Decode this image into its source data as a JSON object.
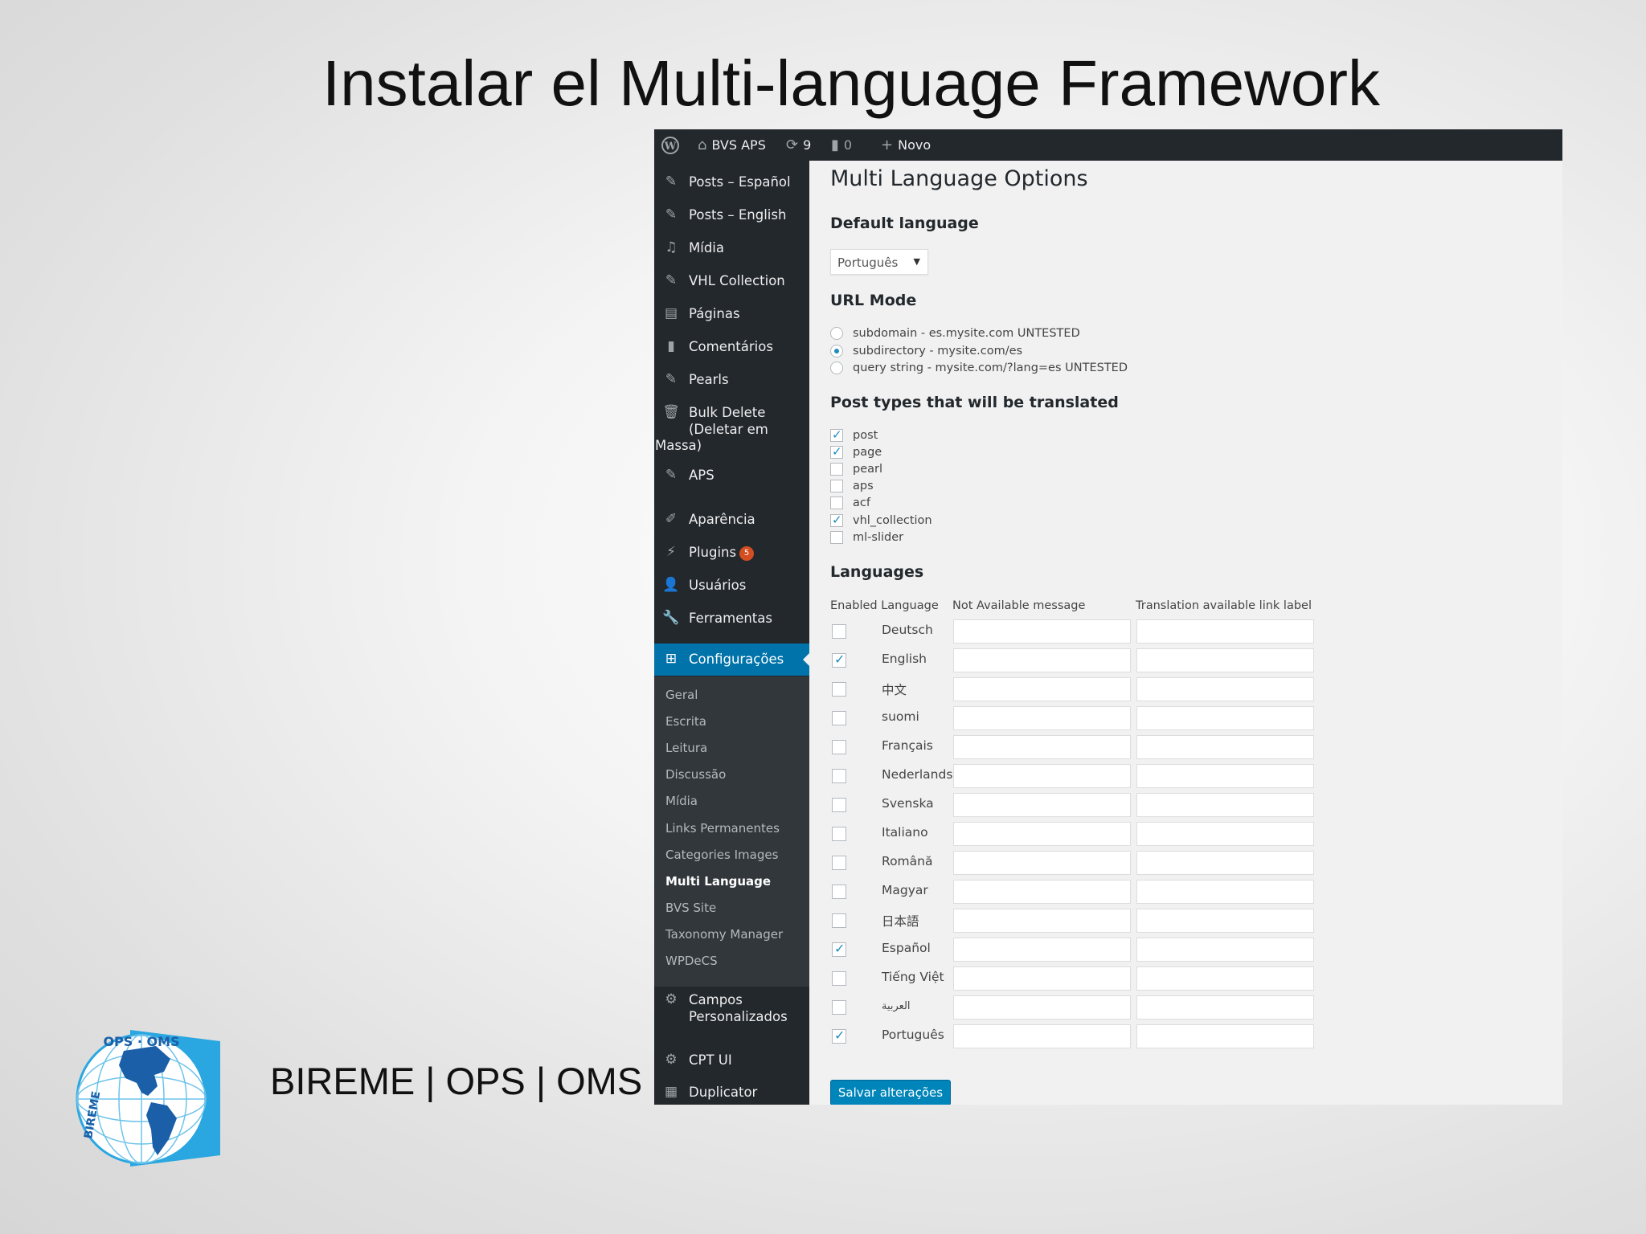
{
  "slide": {
    "title": "Instalar el Multi-language Framework",
    "footer": "BIREME | OPS | OMS",
    "logo_text_top": "OPS · OMS",
    "logo_text_side": "BIREME"
  },
  "topbar": {
    "site_name": "BVS APS",
    "updates_count": "9",
    "comments_count": "0",
    "new_label": "Novo"
  },
  "sidebar": {
    "items": [
      {
        "label": "Posts – Español",
        "icon": "pin-icon"
      },
      {
        "label": "Posts – English",
        "icon": "pin-icon"
      },
      {
        "label": "Mídia",
        "icon": "media-icon"
      },
      {
        "label": "VHL Collection",
        "icon": "pin-icon"
      },
      {
        "label": "Páginas",
        "icon": "pages-icon"
      },
      {
        "label": "Comentários",
        "icon": "comment-icon"
      },
      {
        "label": "Pearls",
        "icon": "pin-icon"
      },
      {
        "label": "Bulk Delete (Deletar em",
        "label2": "Massa)",
        "icon": "trash-icon"
      },
      {
        "label": "APS",
        "icon": "pin-icon"
      },
      {
        "label": "Aparência",
        "icon": "brush-icon"
      },
      {
        "label": "Plugins",
        "badge": "5",
        "icon": "plugin-icon"
      },
      {
        "label": "Usuários",
        "icon": "user-icon"
      },
      {
        "label": "Ferramentas",
        "icon": "wrench-icon"
      },
      {
        "label": "Configurações",
        "icon": "settings-icon"
      },
      {
        "label": "Campos Personalizados",
        "icon": "gear-icon"
      },
      {
        "label": "CPT UI",
        "icon": "gear-icon"
      },
      {
        "label": "Duplicator",
        "icon": "database-icon"
      }
    ],
    "submenu": [
      "Geral",
      "Escrita",
      "Leitura",
      "Discussão",
      "Mídia",
      "Links Permanentes",
      "Categories Images",
      "Multi Language",
      "BVS Site",
      "Taxonomy Manager",
      "WPDeCS"
    ]
  },
  "content": {
    "page_title": "Multi Language Options",
    "default_language_heading": "Default language",
    "default_language_value": "Português",
    "url_mode_heading": "URL Mode",
    "url_modes": [
      {
        "label": "subdomain - es.mysite.com UNTESTED",
        "selected": false
      },
      {
        "label": "subdirectory - mysite.com/es",
        "selected": true
      },
      {
        "label": "query string - mysite.com/?lang=es UNTESTED",
        "selected": false
      }
    ],
    "post_types_heading": "Post types that will be translated",
    "post_types": [
      {
        "label": "post",
        "checked": true
      },
      {
        "label": "page",
        "checked": true
      },
      {
        "label": "pearl",
        "checked": false
      },
      {
        "label": "aps",
        "checked": false
      },
      {
        "label": "acf",
        "checked": false
      },
      {
        "label": "vhl_collection",
        "checked": true
      },
      {
        "label": "ml-slider",
        "checked": false
      }
    ],
    "languages_heading": "Languages",
    "col_enabled": "Enabled Language",
    "col_not_available": "Not Available message",
    "col_translation": "Translation available link label",
    "languages": [
      {
        "name": "Deutsch",
        "enabled": false
      },
      {
        "name": "English",
        "enabled": true
      },
      {
        "name": "中文",
        "enabled": false
      },
      {
        "name": "suomi",
        "enabled": false
      },
      {
        "name": "Français",
        "enabled": false
      },
      {
        "name": "Nederlands",
        "enabled": false
      },
      {
        "name": "Svenska",
        "enabled": false
      },
      {
        "name": "Italiano",
        "enabled": false
      },
      {
        "name": "Română",
        "enabled": false
      },
      {
        "name": "Magyar",
        "enabled": false
      },
      {
        "name": "日本語",
        "enabled": false
      },
      {
        "name": "Español",
        "enabled": true
      },
      {
        "name": "Tiếng Việt",
        "enabled": false
      },
      {
        "name": "العربية",
        "enabled": false
      },
      {
        "name": "Português",
        "enabled": true
      }
    ],
    "save_label": "Salvar alterações"
  }
}
